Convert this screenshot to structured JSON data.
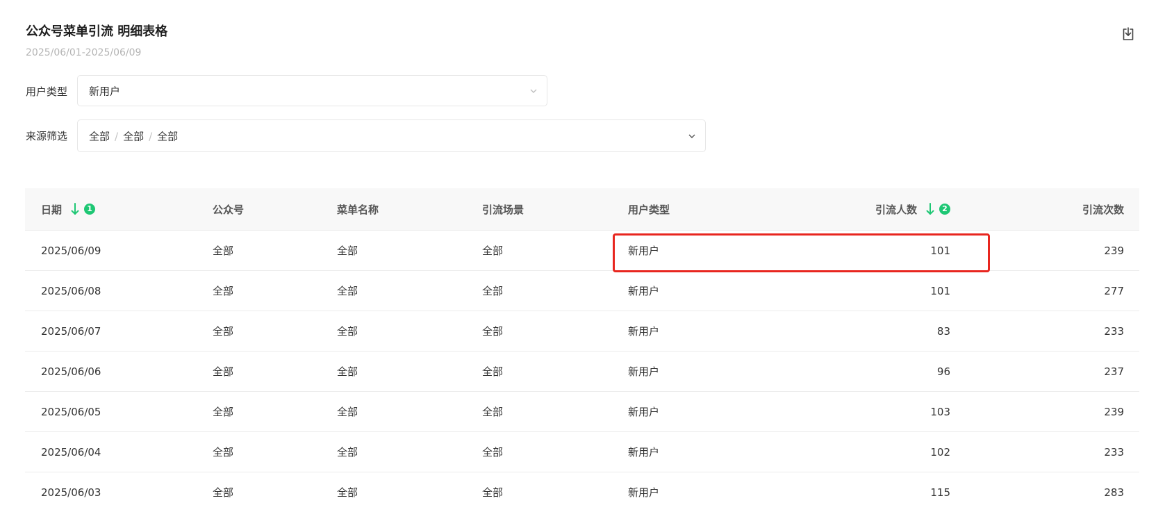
{
  "header": {
    "title": "公众号菜单引流 明细表格",
    "date_range": "2025/06/01-2025/06/09"
  },
  "filters": {
    "user_type": {
      "label": "用户类型",
      "value": "新用户"
    },
    "source": {
      "label": "来源筛选",
      "values": [
        "全部",
        "全部",
        "全部"
      ],
      "separator": "/"
    }
  },
  "table": {
    "columns": {
      "date": "日期",
      "account": "公众号",
      "menu_name": "菜单名称",
      "scene": "引流场景",
      "user_type": "用户类型",
      "people": "引流人数",
      "times": "引流次数"
    },
    "sort": {
      "date_order": "1",
      "people_order": "2"
    },
    "rows": [
      {
        "date": "2025/06/09",
        "account": "全部",
        "menu_name": "全部",
        "scene": "全部",
        "user_type": "新用户",
        "people": "101",
        "times": "239"
      },
      {
        "date": "2025/06/08",
        "account": "全部",
        "menu_name": "全部",
        "scene": "全部",
        "user_type": "新用户",
        "people": "101",
        "times": "277"
      },
      {
        "date": "2025/06/07",
        "account": "全部",
        "menu_name": "全部",
        "scene": "全部",
        "user_type": "新用户",
        "people": "83",
        "times": "233"
      },
      {
        "date": "2025/06/06",
        "account": "全部",
        "menu_name": "全部",
        "scene": "全部",
        "user_type": "新用户",
        "people": "96",
        "times": "237"
      },
      {
        "date": "2025/06/05",
        "account": "全部",
        "menu_name": "全部",
        "scene": "全部",
        "user_type": "新用户",
        "people": "103",
        "times": "239"
      },
      {
        "date": "2025/06/04",
        "account": "全部",
        "menu_name": "全部",
        "scene": "全部",
        "user_type": "新用户",
        "people": "102",
        "times": "233"
      },
      {
        "date": "2025/06/03",
        "account": "全部",
        "menu_name": "全部",
        "scene": "全部",
        "user_type": "新用户",
        "people": "115",
        "times": "283"
      }
    ]
  },
  "icons": {
    "export": "download-icon",
    "dropdown": "chevron-down-icon",
    "sort": "arrow-down-icon"
  },
  "colors": {
    "accent": "#1ec774",
    "highlight": "#e8261f"
  }
}
